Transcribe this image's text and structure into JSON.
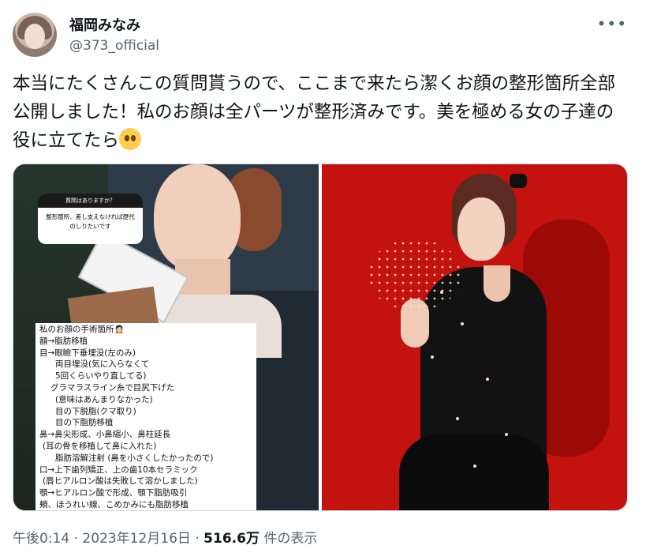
{
  "author": {
    "display_name": "福岡みなみ",
    "handle": "@373_official",
    "avatar_icon": "profile-avatar"
  },
  "menu_icon": "more-options-icon",
  "tweet": {
    "text": "本当にたくさんこの質問貰うので、ここまで来たら潔くお顔の整形箇所全部公開しました！私のお顔は全パーツが整形済みです。美を極める女の子達の役に立てたら",
    "emoji": "pleading-face-emoji"
  },
  "media": {
    "question_box": {
      "header": "質問はありますか？",
      "body": "整形箇所、差し支えなければ歴代のしりたいです"
    },
    "surgery_list": [
      "私のお顔の手術箇所🙍🏻",
      "額→脂肪移植",
      "目→眼瞼下垂埋没(左のみ)",
      "両目埋没(気に入らなくて",
      "5回くらいやり直してる)",
      "グラマラスライン糸で目尻下げた",
      "(意味はあんまりなかった)",
      "目の下脱脂(クマ取り)",
      "目の下脂肪移植",
      "鼻→鼻尖形成、小鼻縮小、鼻柱延長",
      "(耳の骨を移植して鼻に入れた)",
      "脂肪溶解注射 (鼻を小さくしたかったので)",
      "口→上下歯列矯正、上の歯10本セラミック",
      "(唇ヒアルロン酸は失敗して溶かしました)",
      "顎→ヒアルロン酸で形成、顎下脂肪吸引",
      "頬、ほうれい線、こめかみにも脂肪移植"
    ]
  },
  "footer": {
    "time": "午後0:14",
    "separator": " · ",
    "date": "2023年12月16日",
    "views": "516.6万",
    "views_label": "件の表示"
  }
}
